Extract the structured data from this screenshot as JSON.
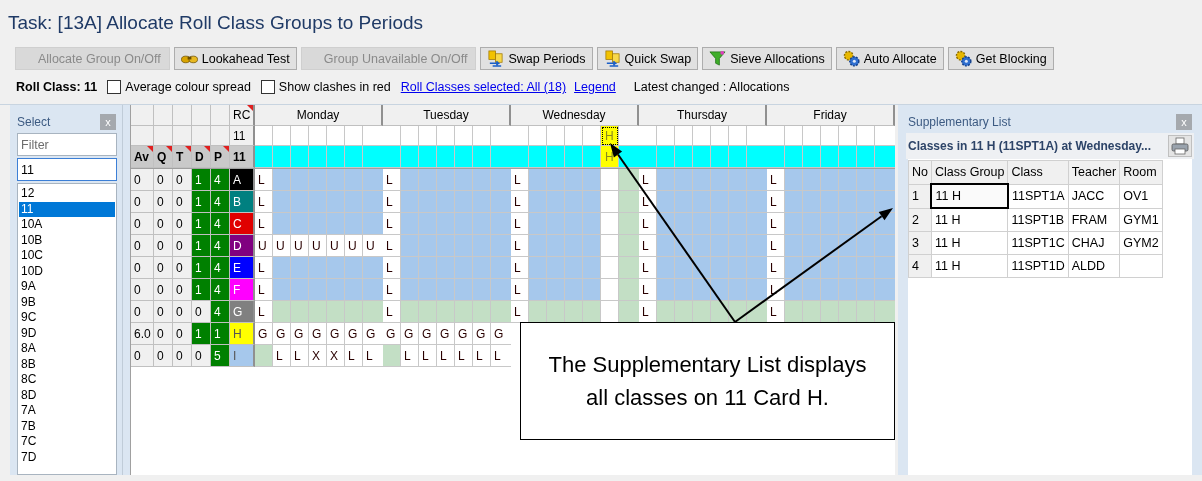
{
  "title": "Task: [13A] Allocate Roll Class Groups to Periods",
  "toolbar": [
    {
      "label": "Allocate Group On/Off",
      "disabled": true,
      "kind": "plain"
    },
    {
      "label": "Lookahead Test",
      "disabled": false,
      "kind": "binoculars"
    },
    {
      "label": "Group Unavailable On/Off",
      "disabled": true,
      "kind": "plain"
    },
    {
      "label": "Swap Periods",
      "disabled": false,
      "kind": "swap"
    },
    {
      "label": "Quick Swap",
      "disabled": false,
      "kind": "swap"
    },
    {
      "label": "Sieve Allocations",
      "disabled": false,
      "kind": "funnel"
    },
    {
      "label": "Auto Allocate",
      "disabled": false,
      "kind": "gears"
    },
    {
      "label": "Get Blocking",
      "disabled": false,
      "kind": "gears"
    }
  ],
  "options": {
    "roll_class": "Roll Class: 11",
    "checkboxes": [
      {
        "label": "Average colour spread",
        "checked": false
      },
      {
        "label": "Show clashes in red",
        "checked": false
      }
    ],
    "links": [
      "Roll Classes selected: All (18)",
      "Legend"
    ],
    "latest": "Latest changed : Allocations"
  },
  "select_panel": {
    "title": "Select",
    "close": "x",
    "filter_placeholder": "Filter",
    "value": "11",
    "items": [
      {
        "label": "12",
        "selected": false
      },
      {
        "label": "11",
        "selected": true
      },
      {
        "label": "10A",
        "selected": false
      },
      {
        "label": "10B",
        "selected": false
      },
      {
        "label": "10C",
        "selected": false
      },
      {
        "label": "10D",
        "selected": false
      },
      {
        "label": "9A",
        "selected": false
      },
      {
        "label": "9B",
        "selected": false
      },
      {
        "label": "9C",
        "selected": false
      },
      {
        "label": "9D",
        "selected": false
      },
      {
        "label": "8A",
        "selected": false
      },
      {
        "label": "8B",
        "selected": false
      },
      {
        "label": "8C",
        "selected": false
      },
      {
        "label": "8D",
        "selected": false
      },
      {
        "label": "7A",
        "selected": false
      },
      {
        "label": "7B",
        "selected": false
      },
      {
        "label": "7C",
        "selected": false
      },
      {
        "label": "7D",
        "selected": false
      }
    ]
  },
  "grid": {
    "rc_label": "RC",
    "rc_value": "11",
    "days": [
      "Monday",
      "Tuesday",
      "Wednesday",
      "Thursday",
      "Friday"
    ],
    "columns": [
      "Av",
      "Q",
      "T",
      "D",
      "P",
      "11"
    ],
    "rc_row": [
      [
        {
          "kind": "white"
        },
        {
          "kind": "white"
        },
        {
          "kind": "white"
        },
        {
          "kind": "white"
        },
        {
          "kind": "white"
        },
        {
          "kind": "white"
        },
        {
          "kind": "white"
        }
      ],
      [
        {
          "kind": "white"
        },
        {
          "kind": "white"
        },
        {
          "kind": "white"
        },
        {
          "kind": "white"
        },
        {
          "kind": "white"
        },
        {
          "kind": "white"
        },
        {
          "kind": "white"
        }
      ],
      [
        {
          "kind": "white"
        },
        {
          "kind": "white"
        },
        {
          "kind": "white"
        },
        {
          "kind": "white"
        },
        {
          "kind": "white"
        },
        {
          "kind": "current",
          "text": "H"
        },
        {
          "kind": "white"
        }
      ],
      [
        {
          "kind": "white"
        },
        {
          "kind": "white"
        },
        {
          "kind": "white"
        },
        {
          "kind": "white"
        },
        {
          "kind": "white"
        },
        {
          "kind": "white"
        },
        {
          "kind": "white"
        }
      ],
      [
        {
          "kind": "white"
        },
        {
          "kind": "white"
        },
        {
          "kind": "white"
        },
        {
          "kind": "white"
        },
        {
          "kind": "white"
        },
        {
          "kind": "white"
        },
        {
          "kind": "white"
        }
      ]
    ],
    "group_row": [
      [
        {
          "kind": "cyan"
        },
        {
          "kind": "cyan"
        },
        {
          "kind": "cyan"
        },
        {
          "kind": "cyan"
        },
        {
          "kind": "cyan"
        },
        {
          "kind": "cyan"
        },
        {
          "kind": "cyan"
        }
      ],
      [
        {
          "kind": "cyan"
        },
        {
          "kind": "cyan"
        },
        {
          "kind": "cyan"
        },
        {
          "kind": "cyan"
        },
        {
          "kind": "cyan"
        },
        {
          "kind": "cyan"
        },
        {
          "kind": "cyan"
        }
      ],
      [
        {
          "kind": "cyan"
        },
        {
          "kind": "cyan"
        },
        {
          "kind": "cyan"
        },
        {
          "kind": "cyan"
        },
        {
          "kind": "cyan"
        },
        {
          "kind": "yellow",
          "text": "H"
        },
        {
          "kind": "cyan"
        }
      ],
      [
        {
          "kind": "cyan"
        },
        {
          "kind": "cyan"
        },
        {
          "kind": "cyan"
        },
        {
          "kind": "cyan"
        },
        {
          "kind": "cyan"
        },
        {
          "kind": "cyan"
        },
        {
          "kind": "cyan"
        }
      ],
      [
        {
          "kind": "cyan"
        },
        {
          "kind": "cyan"
        },
        {
          "kind": "cyan"
        },
        {
          "kind": "cyan"
        },
        {
          "kind": "cyan"
        },
        {
          "kind": "cyan"
        },
        {
          "kind": "cyan"
        }
      ]
    ],
    "rows": [
      {
        "av": "0",
        "q": "0",
        "t": "0",
        "d": "1",
        "p": "4",
        "d_met": true,
        "p_met": true,
        "group": "A",
        "color": "#000000",
        "days": [
          [
            {
              "kind": "white",
              "text": "L"
            },
            {
              "kind": "blue"
            },
            {
              "kind": "blue"
            },
            {
              "kind": "blue"
            },
            {
              "kind": "blue"
            },
            {
              "kind": "blue"
            },
            {
              "kind": "blue"
            }
          ],
          [
            {
              "kind": "white",
              "text": "L"
            },
            {
              "kind": "blue"
            },
            {
              "kind": "blue"
            },
            {
              "kind": "blue"
            },
            {
              "kind": "blue"
            },
            {
              "kind": "blue"
            },
            {
              "kind": "blue"
            }
          ],
          [
            {
              "kind": "white",
              "text": "L"
            },
            {
              "kind": "blue"
            },
            {
              "kind": "blue"
            },
            {
              "kind": "blue"
            },
            {
              "kind": "blue"
            },
            {
              "kind": "white"
            },
            {
              "kind": "green"
            }
          ],
          [
            {
              "kind": "white",
              "text": "L"
            },
            {
              "kind": "blue"
            },
            {
              "kind": "blue"
            },
            {
              "kind": "blue"
            },
            {
              "kind": "blue"
            },
            {
              "kind": "blue"
            },
            {
              "kind": "blue"
            }
          ],
          [
            {
              "kind": "white",
              "text": "L"
            },
            {
              "kind": "blue"
            },
            {
              "kind": "blue"
            },
            {
              "kind": "blue"
            },
            {
              "kind": "blue"
            },
            {
              "kind": "blue"
            },
            {
              "kind": "blue"
            }
          ]
        ]
      },
      {
        "av": "0",
        "q": "0",
        "t": "0",
        "d": "1",
        "p": "4",
        "d_met": true,
        "p_met": true,
        "group": "B",
        "color": "#008080",
        "days": [
          [
            {
              "kind": "white",
              "text": "L"
            },
            {
              "kind": "blue"
            },
            {
              "kind": "blue"
            },
            {
              "kind": "blue"
            },
            {
              "kind": "blue"
            },
            {
              "kind": "blue"
            },
            {
              "kind": "blue"
            }
          ],
          [
            {
              "kind": "white",
              "text": "L"
            },
            {
              "kind": "blue"
            },
            {
              "kind": "blue"
            },
            {
              "kind": "blue"
            },
            {
              "kind": "blue"
            },
            {
              "kind": "blue"
            },
            {
              "kind": "blue"
            }
          ],
          [
            {
              "kind": "white",
              "text": "L"
            },
            {
              "kind": "blue"
            },
            {
              "kind": "blue"
            },
            {
              "kind": "blue"
            },
            {
              "kind": "blue"
            },
            {
              "kind": "white"
            },
            {
              "kind": "green"
            }
          ],
          [
            {
              "kind": "white",
              "text": "L"
            },
            {
              "kind": "blue"
            },
            {
              "kind": "blue"
            },
            {
              "kind": "blue"
            },
            {
              "kind": "blue"
            },
            {
              "kind": "blue"
            },
            {
              "kind": "blue"
            }
          ],
          [
            {
              "kind": "white",
              "text": "L"
            },
            {
              "kind": "blue"
            },
            {
              "kind": "blue"
            },
            {
              "kind": "blue"
            },
            {
              "kind": "blue"
            },
            {
              "kind": "blue"
            },
            {
              "kind": "blue"
            }
          ]
        ]
      },
      {
        "av": "0",
        "q": "0",
        "t": "0",
        "d": "1",
        "p": "4",
        "d_met": true,
        "p_met": true,
        "group": "C",
        "color": "#e00000",
        "days": [
          [
            {
              "kind": "white",
              "text": "L"
            },
            {
              "kind": "blue"
            },
            {
              "kind": "blue"
            },
            {
              "kind": "blue"
            },
            {
              "kind": "blue"
            },
            {
              "kind": "blue"
            },
            {
              "kind": "blue"
            }
          ],
          [
            {
              "kind": "white",
              "text": "L"
            },
            {
              "kind": "blue"
            },
            {
              "kind": "blue"
            },
            {
              "kind": "blue"
            },
            {
              "kind": "blue"
            },
            {
              "kind": "blue"
            },
            {
              "kind": "blue"
            }
          ],
          [
            {
              "kind": "white",
              "text": "L"
            },
            {
              "kind": "blue"
            },
            {
              "kind": "blue"
            },
            {
              "kind": "blue"
            },
            {
              "kind": "blue"
            },
            {
              "kind": "white"
            },
            {
              "kind": "green"
            }
          ],
          [
            {
              "kind": "white",
              "text": "L"
            },
            {
              "kind": "blue"
            },
            {
              "kind": "blue"
            },
            {
              "kind": "blue"
            },
            {
              "kind": "blue"
            },
            {
              "kind": "blue"
            },
            {
              "kind": "blue"
            }
          ],
          [
            {
              "kind": "white",
              "text": "L"
            },
            {
              "kind": "blue"
            },
            {
              "kind": "blue"
            },
            {
              "kind": "blue"
            },
            {
              "kind": "blue"
            },
            {
              "kind": "blue"
            },
            {
              "kind": "blue"
            }
          ]
        ]
      },
      {
        "av": "0",
        "q": "0",
        "t": "0",
        "d": "1",
        "p": "4",
        "d_met": true,
        "p_met": true,
        "group": "D",
        "color": "#800080",
        "days": [
          [
            {
              "kind": "white",
              "text": "U"
            },
            {
              "kind": "white",
              "text": "U"
            },
            {
              "kind": "white",
              "text": "U"
            },
            {
              "kind": "white",
              "text": "U"
            },
            {
              "kind": "white",
              "text": "U"
            },
            {
              "kind": "white",
              "text": "U"
            },
            {
              "kind": "white",
              "text": "U"
            }
          ],
          [
            {
              "kind": "white",
              "text": "L"
            },
            {
              "kind": "blue"
            },
            {
              "kind": "blue"
            },
            {
              "kind": "blue"
            },
            {
              "kind": "blue"
            },
            {
              "kind": "blue"
            },
            {
              "kind": "blue"
            }
          ],
          [
            {
              "kind": "white",
              "text": "L"
            },
            {
              "kind": "blue"
            },
            {
              "kind": "blue"
            },
            {
              "kind": "blue"
            },
            {
              "kind": "blue"
            },
            {
              "kind": "white"
            },
            {
              "kind": "green"
            }
          ],
          [
            {
              "kind": "white",
              "text": "L"
            },
            {
              "kind": "blue"
            },
            {
              "kind": "blue"
            },
            {
              "kind": "blue"
            },
            {
              "kind": "blue"
            },
            {
              "kind": "blue"
            },
            {
              "kind": "blue"
            }
          ],
          [
            {
              "kind": "white",
              "text": "L"
            },
            {
              "kind": "blue"
            },
            {
              "kind": "blue"
            },
            {
              "kind": "blue"
            },
            {
              "kind": "blue"
            },
            {
              "kind": "blue"
            },
            {
              "kind": "blue"
            }
          ]
        ]
      },
      {
        "av": "0",
        "q": "0",
        "t": "0",
        "d": "1",
        "p": "4",
        "d_met": true,
        "p_met": true,
        "group": "E",
        "color": "#0000ff",
        "days": [
          [
            {
              "kind": "white",
              "text": "L"
            },
            {
              "kind": "blue"
            },
            {
              "kind": "blue"
            },
            {
              "kind": "blue"
            },
            {
              "kind": "blue"
            },
            {
              "kind": "blue"
            },
            {
              "kind": "blue"
            }
          ],
          [
            {
              "kind": "white",
              "text": "L"
            },
            {
              "kind": "blue"
            },
            {
              "kind": "blue"
            },
            {
              "kind": "blue"
            },
            {
              "kind": "blue"
            },
            {
              "kind": "blue"
            },
            {
              "kind": "blue"
            }
          ],
          [
            {
              "kind": "white",
              "text": "L"
            },
            {
              "kind": "blue"
            },
            {
              "kind": "blue"
            },
            {
              "kind": "blue"
            },
            {
              "kind": "blue"
            },
            {
              "kind": "white"
            },
            {
              "kind": "green"
            }
          ],
          [
            {
              "kind": "white",
              "text": "L"
            },
            {
              "kind": "blue"
            },
            {
              "kind": "blue"
            },
            {
              "kind": "blue"
            },
            {
              "kind": "blue"
            },
            {
              "kind": "blue"
            },
            {
              "kind": "blue"
            }
          ],
          [
            {
              "kind": "white",
              "text": "L"
            },
            {
              "kind": "blue"
            },
            {
              "kind": "blue"
            },
            {
              "kind": "blue"
            },
            {
              "kind": "blue"
            },
            {
              "kind": "blue"
            },
            {
              "kind": "blue"
            }
          ]
        ]
      },
      {
        "av": "0",
        "q": "0",
        "t": "0",
        "d": "1",
        "p": "4",
        "d_met": true,
        "p_met": true,
        "group": "F",
        "color": "#ff00ff",
        "days": [
          [
            {
              "kind": "white",
              "text": "L"
            },
            {
              "kind": "blue"
            },
            {
              "kind": "blue"
            },
            {
              "kind": "blue"
            },
            {
              "kind": "blue"
            },
            {
              "kind": "blue"
            },
            {
              "kind": "blue"
            }
          ],
          [
            {
              "kind": "white",
              "text": "L"
            },
            {
              "kind": "blue"
            },
            {
              "kind": "blue"
            },
            {
              "kind": "blue"
            },
            {
              "kind": "blue"
            },
            {
              "kind": "blue"
            },
            {
              "kind": "blue"
            }
          ],
          [
            {
              "kind": "white",
              "text": "L"
            },
            {
              "kind": "blue"
            },
            {
              "kind": "blue"
            },
            {
              "kind": "blue"
            },
            {
              "kind": "blue"
            },
            {
              "kind": "white"
            },
            {
              "kind": "green"
            }
          ],
          [
            {
              "kind": "white",
              "text": "L"
            },
            {
              "kind": "blue"
            },
            {
              "kind": "blue"
            },
            {
              "kind": "blue"
            },
            {
              "kind": "blue"
            },
            {
              "kind": "blue"
            },
            {
              "kind": "blue"
            }
          ],
          [
            {
              "kind": "white",
              "text": "L"
            },
            {
              "kind": "blue"
            },
            {
              "kind": "blue"
            },
            {
              "kind": "blue"
            },
            {
              "kind": "blue"
            },
            {
              "kind": "blue"
            },
            {
              "kind": "blue"
            }
          ]
        ]
      },
      {
        "av": "0",
        "q": "0",
        "t": "0",
        "d": "0",
        "p": "4",
        "d_met": false,
        "p_met": true,
        "group": "G",
        "color": "#808080",
        "days": [
          [
            {
              "kind": "white",
              "text": "L"
            },
            {
              "kind": "green"
            },
            {
              "kind": "green"
            },
            {
              "kind": "green"
            },
            {
              "kind": "green"
            },
            {
              "kind": "green"
            },
            {
              "kind": "green"
            }
          ],
          [
            {
              "kind": "white",
              "text": "L"
            },
            {
              "kind": "green"
            },
            {
              "kind": "green"
            },
            {
              "kind": "green"
            },
            {
              "kind": "green"
            },
            {
              "kind": "green"
            },
            {
              "kind": "green"
            }
          ],
          [
            {
              "kind": "white",
              "text": "L"
            },
            {
              "kind": "green"
            },
            {
              "kind": "green"
            },
            {
              "kind": "green"
            },
            {
              "kind": "green"
            },
            {
              "kind": "white"
            },
            {
              "kind": "green"
            }
          ],
          [
            {
              "kind": "white",
              "text": "L"
            },
            {
              "kind": "green"
            },
            {
              "kind": "green"
            },
            {
              "kind": "green"
            },
            {
              "kind": "green"
            },
            {
              "kind": "green"
            },
            {
              "kind": "green"
            }
          ],
          [
            {
              "kind": "white",
              "text": "L"
            },
            {
              "kind": "green"
            },
            {
              "kind": "green"
            },
            {
              "kind": "green"
            },
            {
              "kind": "green"
            },
            {
              "kind": "green"
            },
            {
              "kind": "green"
            }
          ]
        ]
      },
      {
        "av": "6.0",
        "q": "0",
        "t": "0",
        "d": "1",
        "p": "1",
        "d_met": true,
        "p_met": true,
        "group": "H",
        "color": "#ffff00",
        "days": [
          [
            {
              "kind": "white",
              "text": "G"
            },
            {
              "kind": "white",
              "text": "G"
            },
            {
              "kind": "white",
              "text": "G"
            },
            {
              "kind": "white",
              "text": "G"
            },
            {
              "kind": "white",
              "text": "G"
            },
            {
              "kind": "white",
              "text": "G"
            },
            {
              "kind": "white",
              "text": "G"
            }
          ],
          [
            {
              "kind": "white",
              "text": "G"
            },
            {
              "kind": "white",
              "text": "G"
            },
            {
              "kind": "white",
              "text": "G"
            },
            {
              "kind": "white",
              "text": "G"
            },
            {
              "kind": "white",
              "text": "G"
            },
            {
              "kind": "white",
              "text": "G"
            },
            {
              "kind": "white",
              "text": "G"
            }
          ]
        ]
      },
      {
        "av": "0",
        "q": "0",
        "t": "0",
        "d": "0",
        "p": "5",
        "d_met": false,
        "p_met": true,
        "group": "I",
        "color": "#a6c8ec",
        "days": [
          [
            {
              "kind": "green"
            },
            {
              "kind": "white",
              "text": "L"
            },
            {
              "kind": "white",
              "text": "L"
            },
            {
              "kind": "white",
              "text": "X"
            },
            {
              "kind": "white",
              "text": "X"
            },
            {
              "kind": "white",
              "text": "L"
            },
            {
              "kind": "white",
              "text": "L"
            }
          ],
          [
            {
              "kind": "green"
            },
            {
              "kind": "white",
              "text": "L"
            },
            {
              "kind": "white",
              "text": "L"
            },
            {
              "kind": "white",
              "text": "L"
            },
            {
              "kind": "white",
              "text": "L"
            },
            {
              "kind": "white",
              "text": "L"
            },
            {
              "kind": "white",
              "text": "L"
            }
          ]
        ]
      }
    ]
  },
  "supplementary": {
    "title": "Supplementary List",
    "close": "x",
    "heading": "Classes in 11 H (11SPT1A) at Wednesday...",
    "columns": [
      "No",
      "Class Group",
      "Class",
      "Teacher",
      "Room"
    ],
    "rows": [
      {
        "cells": [
          "1",
          "11 H",
          "11SPT1A",
          "JACC",
          "OV1"
        ],
        "focused": true
      },
      {
        "cells": [
          "2",
          "11 H",
          "11SPT1B",
          "FRAM",
          "GYM1"
        ],
        "focused": false
      },
      {
        "cells": [
          "3",
          "11 H",
          "11SPT1C",
          "CHAJ",
          "GYM2"
        ],
        "focused": false
      },
      {
        "cells": [
          "4",
          "11 H",
          "11SPT1D",
          "ALDD"
        ],
        "focused": false
      }
    ]
  },
  "callout": {
    "text": "The Supplementary List displays all classes on 11 Card H."
  }
}
